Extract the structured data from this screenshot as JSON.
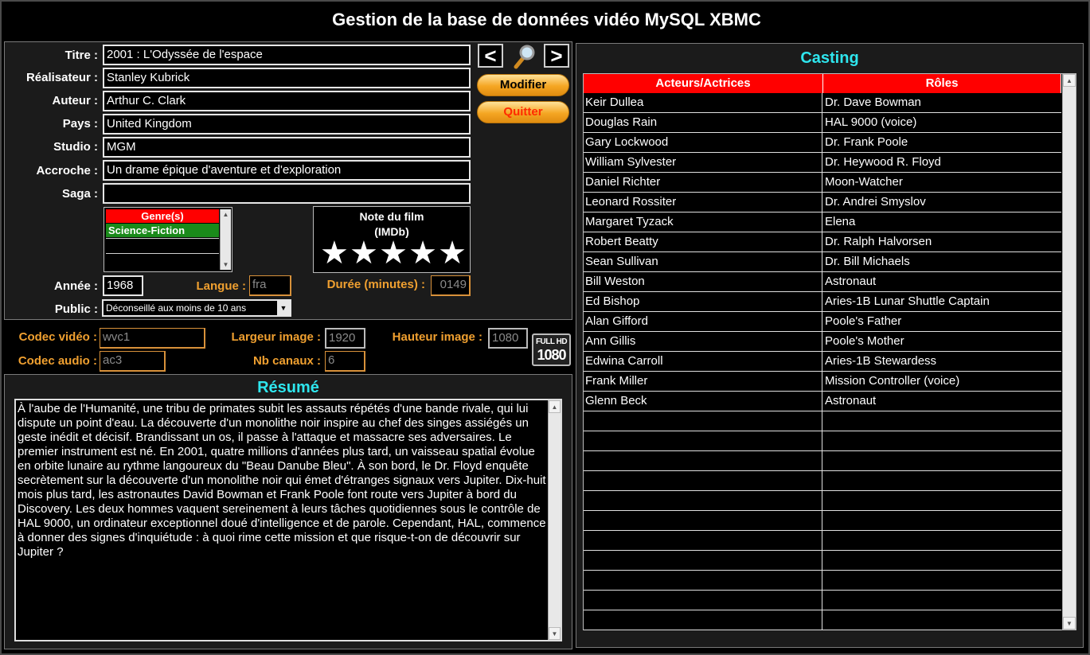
{
  "window": {
    "title": "Gestion de la base de données vidéo MySQL XBMC"
  },
  "form": {
    "titre_label": "Titre :",
    "titre": "2001 : L'Odyssée de l'espace",
    "realisateur_label": "Réalisateur :",
    "realisateur": "Stanley Kubrick",
    "auteur_label": "Auteur :",
    "auteur": "Arthur C. Clark",
    "pays_label": "Pays :",
    "pays": "United Kingdom",
    "studio_label": "Studio :",
    "studio": "MGM",
    "accroche_label": "Accroche :",
    "accroche": "Un drame épique d'aventure et d'exploration",
    "saga_label": "Saga :",
    "saga": "",
    "annee_label": "Année :",
    "annee": "1968",
    "langue_label": "Langue :",
    "langue": "fra",
    "duree_label": "Durée (minutes) :",
    "duree": "0149",
    "public_label": "Public :",
    "public": "Déconseillé aux moins de 10 ans"
  },
  "genres": {
    "header": "Genre(s)",
    "items": [
      "Science-Fiction"
    ]
  },
  "rating": {
    "title_line1": "Note du film",
    "title_line2": "(IMDb)",
    "stars": 5,
    "max": 5
  },
  "buttons": {
    "prev": "<",
    "next": ">",
    "modifier": "Modifier",
    "quitter": "Quitter"
  },
  "icons": {
    "search": "magnifier-icon",
    "hd_badge": "full-hd-1080-icon"
  },
  "technical": {
    "codec_video_label": "Codec vidéo :",
    "codec_video": "wvc1",
    "codec_audio_label": "Codec audio :",
    "codec_audio": "ac3",
    "largeur_label": "Largeur image :",
    "largeur": "1920",
    "hauteur_label": "Hauteur image :",
    "hauteur": "1080",
    "canaux_label": "Nb canaux :",
    "canaux": "6",
    "hd_top": "FULL HD",
    "hd_bottom": "1080"
  },
  "resume": {
    "title": "Résumé",
    "text": "À l'aube de l'Humanité, une tribu de primates subit les assauts répétés d'une bande rivale, qui lui dispute un point d'eau. La découverte d'un monolithe noir inspire au chef des singes assiégés un geste inédit et décisif. Brandissant un os, il passe à l'attaque et massacre ses adversaires. Le premier instrument est né. En 2001, quatre millions d'années plus tard, un vaisseau spatial évolue en orbite lunaire au rythme langoureux du \"Beau Danube Bleu\". À son bord, le Dr. Floyd enquête secrètement sur la découverte d'un monolithe noir qui émet d'étranges signaux vers Jupiter. Dix-huit mois plus tard, les astronautes David Bowman et Frank Poole font route vers Jupiter à bord du Discovery. Les deux hommes vaquent sereinement à leurs tâches quotidiennes sous le contrôle de HAL 9000, un ordinateur exceptionnel doué d'intelligence et de parole. Cependant, HAL, commence à donner des signes d'inquiétude : à quoi rime cette mission et que risque-t-on de découvrir sur Jupiter ?"
  },
  "casting": {
    "title": "Casting",
    "col_actors": "Acteurs/Actrices",
    "col_roles": "Rôles",
    "rows": [
      [
        "Keir Dullea",
        "Dr. Dave Bowman"
      ],
      [
        "Douglas Rain",
        "HAL 9000 (voice)"
      ],
      [
        "Gary Lockwood",
        "Dr. Frank Poole"
      ],
      [
        "William Sylvester",
        "Dr. Heywood R. Floyd"
      ],
      [
        "Daniel Richter",
        "Moon-Watcher"
      ],
      [
        "Leonard Rossiter",
        "Dr. Andrei Smyslov"
      ],
      [
        "Margaret Tyzack",
        "Elena"
      ],
      [
        "Robert Beatty",
        "Dr. Ralph Halvorsen"
      ],
      [
        "Sean Sullivan",
        "Dr. Bill Michaels"
      ],
      [
        "Bill Weston",
        "Astronaut"
      ],
      [
        "Ed Bishop",
        "Aries-1B Lunar Shuttle Captain"
      ],
      [
        "Alan Gifford",
        "Poole's Father"
      ],
      [
        "Ann Gillis",
        "Poole's Mother"
      ],
      [
        "Edwina Carroll",
        "Aries-1B Stewardess"
      ],
      [
        "Frank Miller",
        "Mission Controller (voice)"
      ],
      [
        "Glenn Beck",
        "Astronaut"
      ]
    ],
    "empty_rows": 11
  }
}
